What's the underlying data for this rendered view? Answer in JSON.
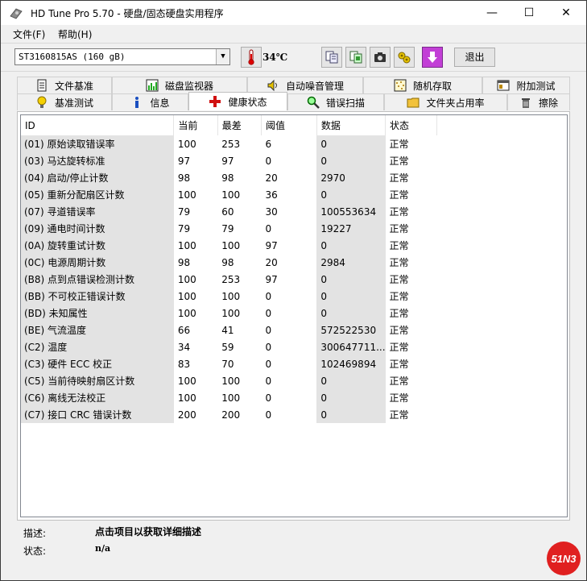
{
  "window": {
    "title": "HD Tune Pro 5.70 - 硬盘/固态硬盘实用程序",
    "minimize": "—",
    "maximize": "☐",
    "close": "✕"
  },
  "menu": {
    "file": "文件(F)",
    "help": "帮助(H)"
  },
  "toolbar": {
    "drive": "ST3160815AS (160 gB)",
    "temperature": "34℃",
    "exit_label": "退出",
    "icons": [
      "copy-text-icon",
      "copy-screenshot-icon",
      "camera-icon",
      "options-icon",
      "save-icon"
    ]
  },
  "tabs_top": [
    {
      "label": "文件基准",
      "icon": "document-icon"
    },
    {
      "label": "磁盘监视器",
      "icon": "monitor-chart-icon"
    },
    {
      "label": "自动噪音管理",
      "icon": "speaker-icon"
    },
    {
      "label": "随机存取",
      "icon": "random-dots-icon"
    },
    {
      "label": "附加测试",
      "icon": "extra-tests-icon"
    }
  ],
  "tabs_bottom": [
    {
      "label": "基准测试",
      "icon": "lightbulb-icon"
    },
    {
      "label": "信息",
      "icon": "info-icon"
    },
    {
      "label": "健康状态",
      "icon": "health-cross-icon",
      "active": true
    },
    {
      "label": "错误扫描",
      "icon": "magnifier-icon"
    },
    {
      "label": "文件夹占用率",
      "icon": "folder-icon"
    },
    {
      "label": "擦除",
      "icon": "trash-icon"
    }
  ],
  "table": {
    "columns": [
      "ID",
      "当前",
      "最差",
      "阈值",
      "数据",
      "状态"
    ],
    "rows": [
      [
        "(01) 原始读取错误率",
        "100",
        "253",
        "6",
        "0",
        "正常"
      ],
      [
        "(03) 马达旋转标准",
        "97",
        "97",
        "0",
        "0",
        "正常"
      ],
      [
        "(04) 启动/停止计数",
        "98",
        "98",
        "20",
        "2970",
        "正常"
      ],
      [
        "(05) 重新分配扇区计数",
        "100",
        "100",
        "36",
        "0",
        "正常"
      ],
      [
        "(07) 寻道错误率",
        "79",
        "60",
        "30",
        "100553634",
        "正常"
      ],
      [
        "(09) 通电时间计数",
        "79",
        "79",
        "0",
        "19227",
        "正常"
      ],
      [
        "(0A) 旋转重试计数",
        "100",
        "100",
        "97",
        "0",
        "正常"
      ],
      [
        "(0C) 电源周期计数",
        "98",
        "98",
        "20",
        "2984",
        "正常"
      ],
      [
        "(B8) 点到点错误检测计数",
        "100",
        "253",
        "97",
        "0",
        "正常"
      ],
      [
        "(BB) 不可校正错误计数",
        "100",
        "100",
        "0",
        "0",
        "正常"
      ],
      [
        "(BD) 未知属性",
        "100",
        "100",
        "0",
        "0",
        "正常"
      ],
      [
        "(BE) 气流温度",
        "66",
        "41",
        "0",
        "572522530",
        "正常"
      ],
      [
        "(C2) 温度",
        "34",
        "59",
        "0",
        "300647711...",
        "正常"
      ],
      [
        "(C3) 硬件 ECC 校正",
        "83",
        "70",
        "0",
        "102469894",
        "正常"
      ],
      [
        "(C5) 当前待映射扇区计数",
        "100",
        "100",
        "0",
        "0",
        "正常"
      ],
      [
        "(C6) 离线无法校正",
        "100",
        "100",
        "0",
        "0",
        "正常"
      ],
      [
        "(C7) 接口 CRC 错误计数",
        "200",
        "200",
        "0",
        "0",
        "正常"
      ]
    ]
  },
  "footer": {
    "desc_label": "描述:",
    "desc_text": "点击项目以获取详细描述",
    "status_label": "状态:",
    "status_text": "n/a"
  },
  "watermark": "51N3"
}
